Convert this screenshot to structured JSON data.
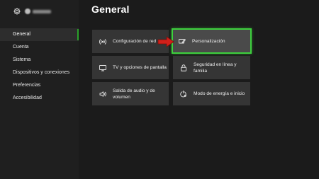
{
  "page": {
    "title": "General"
  },
  "sidebar": {
    "items": [
      {
        "label": "General",
        "active": true
      },
      {
        "label": "Cuenta",
        "active": false
      },
      {
        "label": "Sistema",
        "active": false
      },
      {
        "label": "Dispositivos y conexiones",
        "active": false
      },
      {
        "label": "Preferencias",
        "active": false
      },
      {
        "label": "Accesibilidad",
        "active": false
      }
    ]
  },
  "tiles": [
    {
      "label": "Configuración de red",
      "icon": "network-icon"
    },
    {
      "label": "Personalización",
      "icon": "personalization-icon",
      "selected": true
    },
    {
      "label": "TV y opciones de pantalla",
      "icon": "tv-icon"
    },
    {
      "label": "Seguridad en línea y familia",
      "icon": "lock-icon"
    },
    {
      "label": "Salida de audio y de volumen",
      "icon": "speaker-icon"
    },
    {
      "label": "Modo de energía e inicio",
      "icon": "power-settings-icon"
    }
  ],
  "colors": {
    "background": "#1b1b1b",
    "sidebar": "#1f1f1f",
    "tile": "#353535",
    "tile_selected": "#4a4a4a",
    "accent_green": "#3dd13d",
    "annotation_arrow": "#d0201a"
  }
}
